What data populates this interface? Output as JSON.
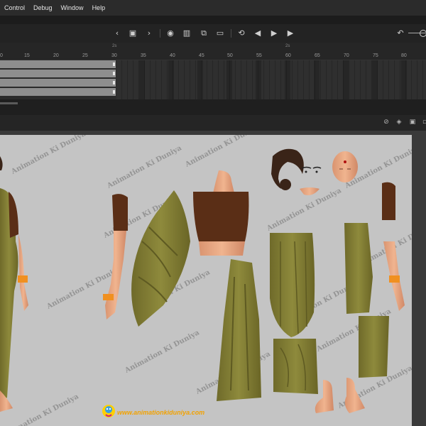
{
  "menu": {
    "items": [
      "Control",
      "Debug",
      "Window",
      "Help"
    ]
  },
  "toolbar": {
    "icons": [
      "chevron-left-icon",
      "center-frame-icon",
      "chevron-right-icon",
      "onion-skin-icon",
      "onion-outline-icon",
      "edit-multiple-icon",
      "frame-marker-icon",
      "loop-icon",
      "step-back-icon",
      "play-icon",
      "step-forward-icon",
      "undo-icon"
    ]
  },
  "ruler": {
    "ticks": [
      "0",
      "15",
      "20",
      "25",
      "30",
      "35",
      "40",
      "45",
      "50",
      "55",
      "60",
      "65",
      "70",
      "75",
      "80"
    ],
    "markers": [
      "2s",
      "2s"
    ]
  },
  "canvas": {
    "watermark": "Animation Ki Duniya",
    "footer_url": "www.animationkiduniya.com"
  },
  "colors": {
    "saree": "#8a8438",
    "blouse": "#5a2e16",
    "skin": "#e8a882",
    "hair": "#3a2418",
    "canvas_bg": "#c4c4c4"
  }
}
